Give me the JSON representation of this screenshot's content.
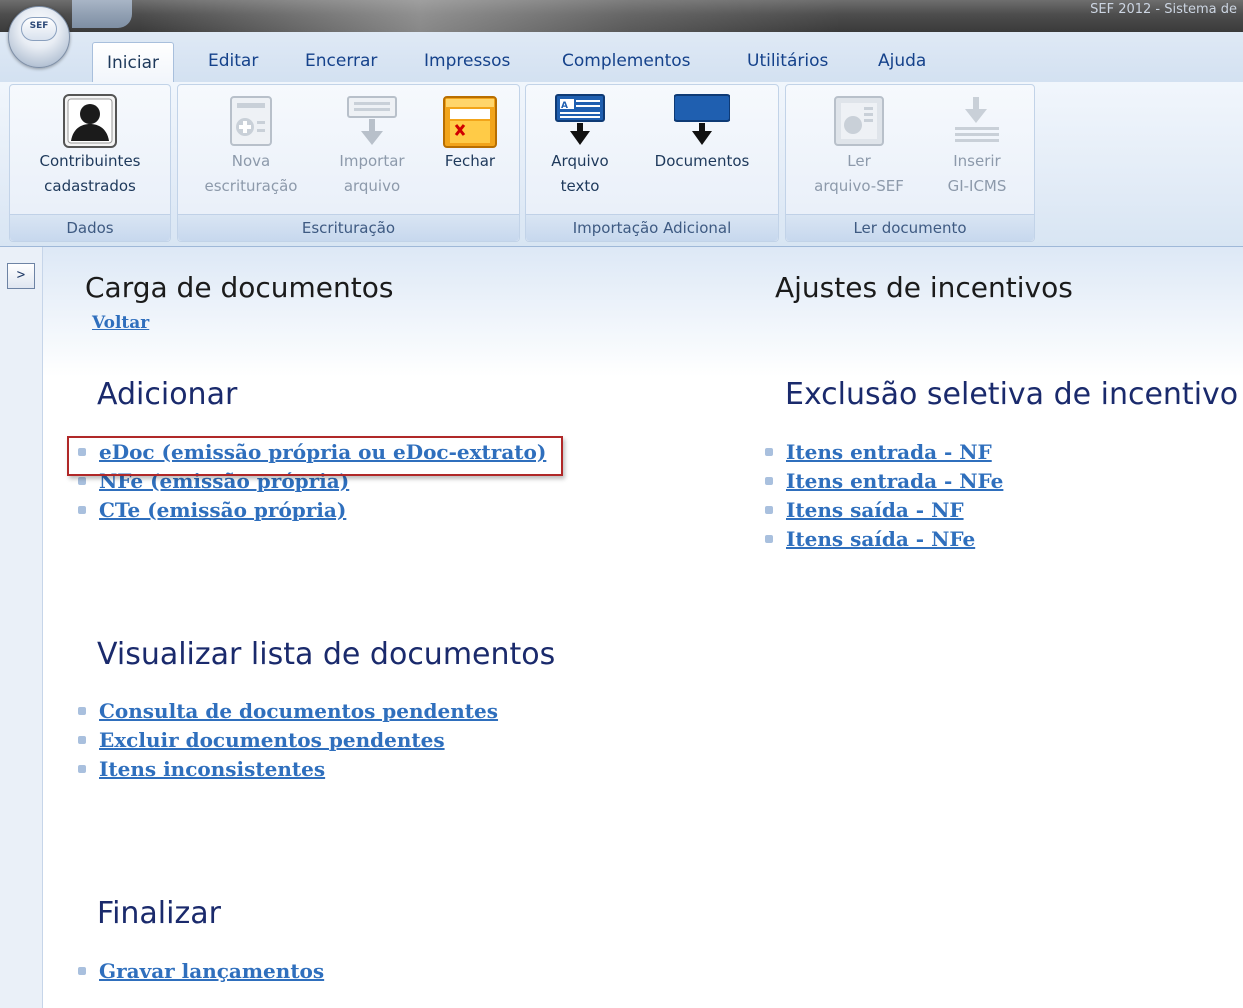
{
  "window": {
    "title": "SEF 2012 - Sistema de"
  },
  "app_button": {
    "label": "SEF"
  },
  "tabs": [
    {
      "label": "Iniciar",
      "active": true
    },
    {
      "label": "Editar"
    },
    {
      "label": "Encerrar"
    },
    {
      "label": "Impressos"
    },
    {
      "label": "Complementos"
    },
    {
      "label": "Utilitários"
    },
    {
      "label": "Ajuda"
    }
  ],
  "ribbon": {
    "groups": {
      "dados": {
        "label": "Dados",
        "buttons": [
          {
            "line1": "Contribuintes",
            "line2": "cadastrados",
            "icon": "user-icon",
            "enabled": true
          }
        ]
      },
      "escrituracao": {
        "label": "Escrituração",
        "buttons": [
          {
            "line1": "Nova",
            "line2": "escrituração",
            "icon": "new-document-icon",
            "enabled": false
          },
          {
            "line1": "Importar",
            "line2": "arquivo",
            "icon": "import-arrow-icon",
            "enabled": false
          },
          {
            "line1": "Fechar",
            "line2": "",
            "icon": "close-folder-icon",
            "enabled": true
          }
        ]
      },
      "importacao": {
        "label": "Importação Adicional",
        "buttons": [
          {
            "line1": "Arquivo",
            "line2": "texto",
            "icon": "text-file-import-icon",
            "enabled": true
          },
          {
            "line1": "Documentos",
            "line2": "",
            "icon": "documents-import-icon",
            "enabled": true
          }
        ]
      },
      "ler_documento": {
        "label": "Ler documento",
        "buttons": [
          {
            "line1": "Ler",
            "line2": "arquivo-SEF",
            "icon": "read-file-icon",
            "enabled": false
          },
          {
            "line1": "Inserir",
            "line2": "GI-ICMS",
            "icon": "insert-icon",
            "enabled": false
          }
        ]
      }
    }
  },
  "sidebar": {
    "expand_label": ">"
  },
  "content": {
    "left": {
      "title": "Carga de documentos",
      "back_link": "Voltar",
      "adicionar": {
        "title": "Adicionar",
        "links": [
          "eDoc (emissão própria ou eDoc-extrato)",
          "NFe (emissão própria)",
          "CTe (emissão própria)"
        ]
      },
      "visualizar": {
        "title": "Visualizar lista de documentos",
        "links": [
          "Consulta de documentos pendentes",
          "Excluir documentos pendentes",
          "Itens inconsistentes"
        ]
      },
      "finalizar": {
        "title": "Finalizar",
        "links": [
          "Gravar lançamentos"
        ]
      }
    },
    "right": {
      "title": "Ajustes de incentivos",
      "exclusao": {
        "title": "Exclusão seletiva de incentivo",
        "links": [
          "Itens entrada - NF",
          "Itens entrada - NFe",
          "Itens saída - NF",
          "Itens saída - NFe"
        ]
      }
    }
  },
  "colors": {
    "link": "#2f6fbd",
    "heading": "#1a2a6c",
    "highlight": "#b02828",
    "tab_text": "#15428b"
  }
}
